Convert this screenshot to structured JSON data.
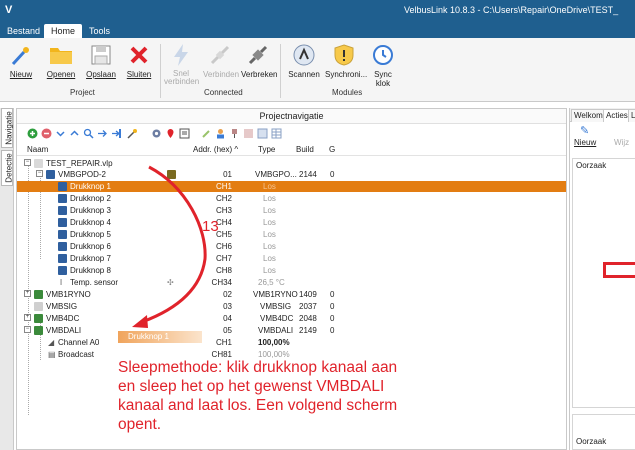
{
  "window": {
    "app_logo": "V",
    "title": "VelbusLink 10.8.3 - C:\\Users\\Repair\\OneDrive\\TEST_"
  },
  "menu": {
    "tabs": [
      "Bestand",
      "Home",
      "Tools"
    ]
  },
  "ribbon": {
    "project_label": "Project",
    "connected_label": "Connected",
    "modules_label": "Modules",
    "buttons": {
      "nieuw": "Nieuw",
      "openen": "Openen",
      "opslaan": "Opslaan",
      "sluiten": "Sluiten",
      "snel_verbinden_1": "Snel",
      "snel_verbinden_2": "verbinden",
      "verbinden": "Verbinden",
      "verbreken": "Verbreken",
      "scannen": "Scannen",
      "synchroni": "Synchroni...",
      "sync_klok": "Sync klok"
    }
  },
  "side_tabs": [
    "Navigatie",
    "Detectie"
  ],
  "panel": {
    "title": "Projectnavigatie",
    "columns": {
      "naam": "Naam",
      "addr": "Addr. (hex) ^",
      "type": "Type",
      "build": "Build",
      "g": "G"
    },
    "rows": [
      {
        "name": "TEST_REPAIR.vlp",
        "addr": "",
        "type": "",
        "build": "",
        "g": ""
      },
      {
        "name": "VMBGPOD-2",
        "addr": "01",
        "type": "VMBGPO...",
        "build": "2144",
        "g": "0"
      },
      {
        "name": "Drukknop 1",
        "addr": "CH1",
        "type": "Los",
        "build": "",
        "g": ""
      },
      {
        "name": "Drukknop 2",
        "addr": "CH2",
        "type": "Los",
        "build": "",
        "g": ""
      },
      {
        "name": "Drukknop 3",
        "addr": "CH3",
        "type": "Los",
        "build": "",
        "g": ""
      },
      {
        "name": "Drukknop 4",
        "addr": "CH4",
        "type": "Los",
        "build": "",
        "g": ""
      },
      {
        "name": "Drukknop 5",
        "addr": "CH5",
        "type": "Los",
        "build": "",
        "g": ""
      },
      {
        "name": "Drukknop 6",
        "addr": "CH6",
        "type": "Los",
        "build": "",
        "g": ""
      },
      {
        "name": "Drukknop 7",
        "addr": "CH7",
        "type": "Los",
        "build": "",
        "g": ""
      },
      {
        "name": "Drukknop 8",
        "addr": "CH8",
        "type": "Los",
        "build": "",
        "g": ""
      },
      {
        "name": "Temp. sensor",
        "addr": "CH34",
        "type": "26,5 °C",
        "build": "",
        "g": ""
      },
      {
        "name": "VMB1RYNO",
        "addr": "02",
        "type": "VMB1RYNO",
        "build": "1409",
        "g": "0"
      },
      {
        "name": "VMBSIG",
        "addr": "03",
        "type": "VMBSIG",
        "build": "2037",
        "g": "0"
      },
      {
        "name": "VMB4DC",
        "addr": "04",
        "type": "VMB4DC",
        "build": "2048",
        "g": "0"
      },
      {
        "name": "VMBDALI",
        "addr": "05",
        "type": "VMBDALI",
        "build": "2149",
        "g": "0"
      },
      {
        "name": "Channel A0",
        "addr": "CH1",
        "type": "100,00%",
        "build": "",
        "g": ""
      },
      {
        "name": "Broadcast",
        "addr": "CH81",
        "type": "100,00%",
        "build": "",
        "g": ""
      }
    ],
    "drag_ghost": "Drukknop 1"
  },
  "annotation": {
    "number": "13",
    "text": "Sleepmethode: klik drukknop kanaal aan en sleep het op het gewenst VMBDALI kanaal and laat los. Een volgend scherm opent."
  },
  "right_panel": {
    "tabs": [
      "Welkom",
      "Acties",
      "Lo"
    ],
    "nieuw": "Nieuw",
    "wijz": "Wijz",
    "oorzaak_1": "Oorzaak",
    "oorzaak_2": "Oorzaak"
  },
  "colors": {
    "titlebar": "#1f5f8f",
    "selected_row": "#e37d12",
    "annotation": "#e0232b"
  }
}
